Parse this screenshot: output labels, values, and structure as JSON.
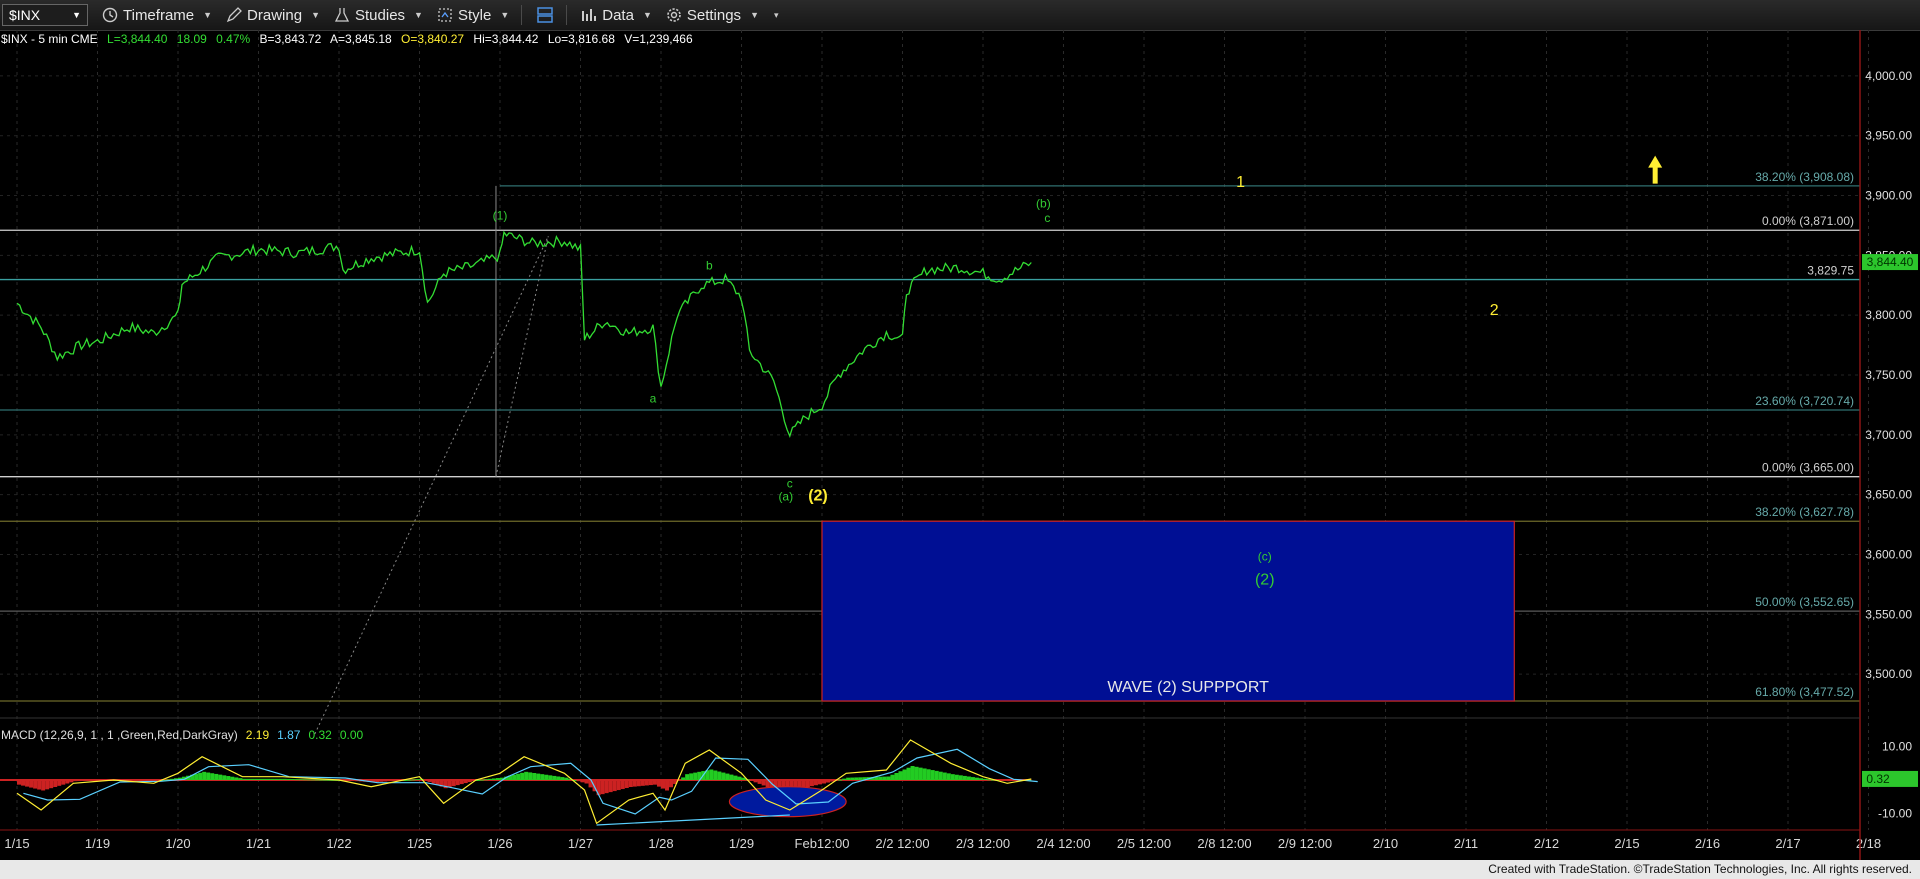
{
  "toolbar": {
    "symbol": "$INX",
    "timeframe": "Timeframe",
    "drawing": "Drawing",
    "studies": "Studies",
    "style": "Style",
    "data": "Data",
    "settings": "Settings"
  },
  "header": {
    "symbol_desc": "$INX - 5 min  CME",
    "last": "L=3,844.40",
    "change": "18.09",
    "change_pct": "0.47%",
    "bid": "B=3,843.72",
    "ask": "A=3,845.18",
    "open": "O=3,840.27",
    "high": "Hi=3,844.42",
    "low": "Lo=3,816.68",
    "volume": "V=1,239,466"
  },
  "chart_data": {
    "type": "line",
    "price_axis": {
      "ylim": [
        3470,
        4030
      ],
      "ticks": [
        4000,
        3950,
        3900,
        3850,
        3800,
        3750,
        3700,
        3650,
        3600,
        3550,
        3500
      ],
      "tick_labels": [
        "4,000.00",
        "3,950.00",
        "3,900.00",
        "3,850.00",
        "3,800.00",
        "3,750.00",
        "3,700.00",
        "3,650.00",
        "3,600.00",
        "3,550.00",
        "3,500.00"
      ]
    },
    "x_labels": [
      "1/15",
      "1/19",
      "1/20",
      "1/21",
      "1/22",
      "1/25",
      "1/26",
      "1/27",
      "1/28",
      "1/29",
      "Feb12:00",
      "2/2 12:00",
      "2/3 12:00",
      "2/4 12:00",
      "2/5 12:00",
      "2/8 12:00",
      "2/9 12:00",
      "2/10",
      "2/11",
      "2/12",
      "2/15",
      "2/16",
      "2/17",
      "2/18"
    ],
    "price_series": [
      {
        "x": 0.0,
        "y": 3810
      },
      {
        "x": 0.3,
        "y": 3790
      },
      {
        "x": 0.5,
        "y": 3765
      },
      {
        "x": 0.8,
        "y": 3775
      },
      {
        "x": 1.0,
        "y": 3778
      },
      {
        "x": 1.4,
        "y": 3790
      },
      {
        "x": 1.7,
        "y": 3785
      },
      {
        "x": 2.0,
        "y": 3800
      },
      {
        "x": 2.05,
        "y": 3826
      },
      {
        "x": 2.5,
        "y": 3848
      },
      {
        "x": 3.0,
        "y": 3855
      },
      {
        "x": 3.5,
        "y": 3852
      },
      {
        "x": 4.0,
        "y": 3858
      },
      {
        "x": 4.05,
        "y": 3838
      },
      {
        "x": 4.4,
        "y": 3848
      },
      {
        "x": 5.0,
        "y": 3855
      },
      {
        "x": 5.1,
        "y": 3810
      },
      {
        "x": 5.3,
        "y": 3835
      },
      {
        "x": 5.7,
        "y": 3842
      },
      {
        "x": 6.0,
        "y": 3850
      },
      {
        "x": 6.05,
        "y": 3868
      },
      {
        "x": 6.4,
        "y": 3860
      },
      {
        "x": 6.8,
        "y": 3862
      },
      {
        "x": 7.0,
        "y": 3855
      },
      {
        "x": 7.05,
        "y": 3780
      },
      {
        "x": 7.3,
        "y": 3795
      },
      {
        "x": 7.6,
        "y": 3785
      },
      {
        "x": 7.9,
        "y": 3790
      },
      {
        "x": 8.0,
        "y": 3740
      },
      {
        "x": 8.2,
        "y": 3800
      },
      {
        "x": 8.5,
        "y": 3825
      },
      {
        "x": 8.8,
        "y": 3830
      },
      {
        "x": 9.0,
        "y": 3815
      },
      {
        "x": 9.1,
        "y": 3770
      },
      {
        "x": 9.4,
        "y": 3745
      },
      {
        "x": 9.6,
        "y": 3700
      },
      {
        "x": 9.8,
        "y": 3715
      },
      {
        "x": 10.0,
        "y": 3725
      },
      {
        "x": 10.2,
        "y": 3750
      },
      {
        "x": 10.5,
        "y": 3770
      },
      {
        "x": 10.8,
        "y": 3785
      },
      {
        "x": 11.0,
        "y": 3780
      },
      {
        "x": 11.05,
        "y": 3820
      },
      {
        "x": 11.3,
        "y": 3838
      },
      {
        "x": 11.7,
        "y": 3840
      },
      {
        "x": 12.0,
        "y": 3835
      },
      {
        "x": 12.2,
        "y": 3830
      },
      {
        "x": 12.6,
        "y": 3844
      }
    ],
    "horizontal_levels": [
      {
        "price": 3908.08,
        "label": "38.20% (3,908.08)",
        "color": "#2f6f6f",
        "x_start": 6.0
      },
      {
        "price": 3871.0,
        "label": "0.00% (3,871.00)",
        "color": "#d0d0d0",
        "x_start": 0.0
      },
      {
        "price": 3829.75,
        "label": "3,829.75",
        "color": "#3aa0a0",
        "x_start": 0.0
      },
      {
        "price": 3720.74,
        "label": "23.60% (3,720.74)",
        "color": "#2f6f6f",
        "x_start": 0.0
      },
      {
        "price": 3665.0,
        "label": "0.00% (3,665.00)",
        "color": "#d0d0d0",
        "x_start": 0.0
      },
      {
        "price": 3627.78,
        "label": "38.20% (3,627.78)",
        "color": "#6e6a2a",
        "x_start": 0.0
      },
      {
        "price": 3552.65,
        "label": "50.00% (3,552.65)",
        "color": "#5a5a5a",
        "x_start": 0.0
      },
      {
        "price": 3477.52,
        "label": "61.80% (3,477.52)",
        "color": "#6e6a2a",
        "x_start": 0.0
      }
    ],
    "last_price_tag": "3,844.40",
    "support_box": {
      "x_start": 10.0,
      "x_end": 18.6,
      "y_top": 3627.78,
      "y_bottom": 3477.52,
      "label": "WAVE (2) SUPPPORT"
    },
    "wave_labels": [
      {
        "text": "(1)",
        "x": 6.0,
        "price": 3880,
        "color": "#33cc33"
      },
      {
        "text": "a",
        "x": 7.9,
        "price": 3727,
        "color": "#33cc33"
      },
      {
        "text": "b",
        "x": 8.6,
        "price": 3838,
        "color": "#33cc33"
      },
      {
        "text": "c",
        "x": 9.6,
        "price": 3656,
        "color": "#33cc33"
      },
      {
        "text": "(a)",
        "x": 9.55,
        "price": 3645,
        "color": "#33cc33"
      },
      {
        "text": "(2)",
        "x": 9.95,
        "price": 3645,
        "color": "#ffee33"
      },
      {
        "text": "(b)",
        "x": 12.75,
        "price": 3890,
        "color": "#33cc33"
      },
      {
        "text": "c",
        "x": 12.8,
        "price": 3878,
        "color": "#33cc33"
      },
      {
        "text": "1",
        "x": 15.2,
        "price": 3907,
        "color": "#ffee33"
      },
      {
        "text": "2",
        "x": 18.35,
        "price": 3800,
        "color": "#ffee33"
      },
      {
        "text": "(c)",
        "x": 15.5,
        "price": 3595,
        "color": "#33cc33"
      },
      {
        "text": "(2)",
        "x": 15.5,
        "price": 3575,
        "color": "#33cc33"
      }
    ],
    "up_arrow": {
      "x": 20.35,
      "price": 3915
    },
    "macd": {
      "label": "MACD (12,26,9, 1  , 1 ,Green,Red,DarkGray)",
      "values": [
        "2.19",
        "1.87",
        "0.32",
        "0.00"
      ],
      "axis_ticks": [
        "10.00",
        "-10.00"
      ],
      "last_tag": "0.32",
      "series": [
        {
          "x": 0.0,
          "y": -4
        },
        {
          "x": 0.3,
          "y": -9
        },
        {
          "x": 0.7,
          "y": -1
        },
        {
          "x": 1.2,
          "y": 0
        },
        {
          "x": 1.7,
          "y": -1
        },
        {
          "x": 2.0,
          "y": 2
        },
        {
          "x": 2.3,
          "y": 7
        },
        {
          "x": 2.8,
          "y": 1
        },
        {
          "x": 3.3,
          "y": 1
        },
        {
          "x": 4.0,
          "y": 0
        },
        {
          "x": 4.4,
          "y": -2
        },
        {
          "x": 5.0,
          "y": 1
        },
        {
          "x": 5.3,
          "y": -7
        },
        {
          "x": 5.7,
          "y": 0
        },
        {
          "x": 6.0,
          "y": 2
        },
        {
          "x": 6.3,
          "y": 7
        },
        {
          "x": 6.8,
          "y": 2
        },
        {
          "x": 7.05,
          "y": -3
        },
        {
          "x": 7.2,
          "y": -13
        },
        {
          "x": 7.6,
          "y": -6
        },
        {
          "x": 7.9,
          "y": -4
        },
        {
          "x": 8.05,
          "y": -9
        },
        {
          "x": 8.3,
          "y": 5
        },
        {
          "x": 8.6,
          "y": 9
        },
        {
          "x": 9.0,
          "y": 2
        },
        {
          "x": 9.3,
          "y": -6
        },
        {
          "x": 9.6,
          "y": -9
        },
        {
          "x": 10.0,
          "y": -3
        },
        {
          "x": 10.3,
          "y": 2
        },
        {
          "x": 10.8,
          "y": 3
        },
        {
          "x": 11.1,
          "y": 12
        },
        {
          "x": 11.6,
          "y": 5
        },
        {
          "x": 12.0,
          "y": 1
        },
        {
          "x": 12.3,
          "y": -1
        },
        {
          "x": 12.6,
          "y": 0.3
        }
      ],
      "ellipse": {
        "x_start": 8.85,
        "x_end": 10.3,
        "y_min": -11,
        "y_max": -2
      }
    }
  },
  "footer": "Created with TradeStation. ©TradeStation Technologies, Inc. All rights reserved."
}
